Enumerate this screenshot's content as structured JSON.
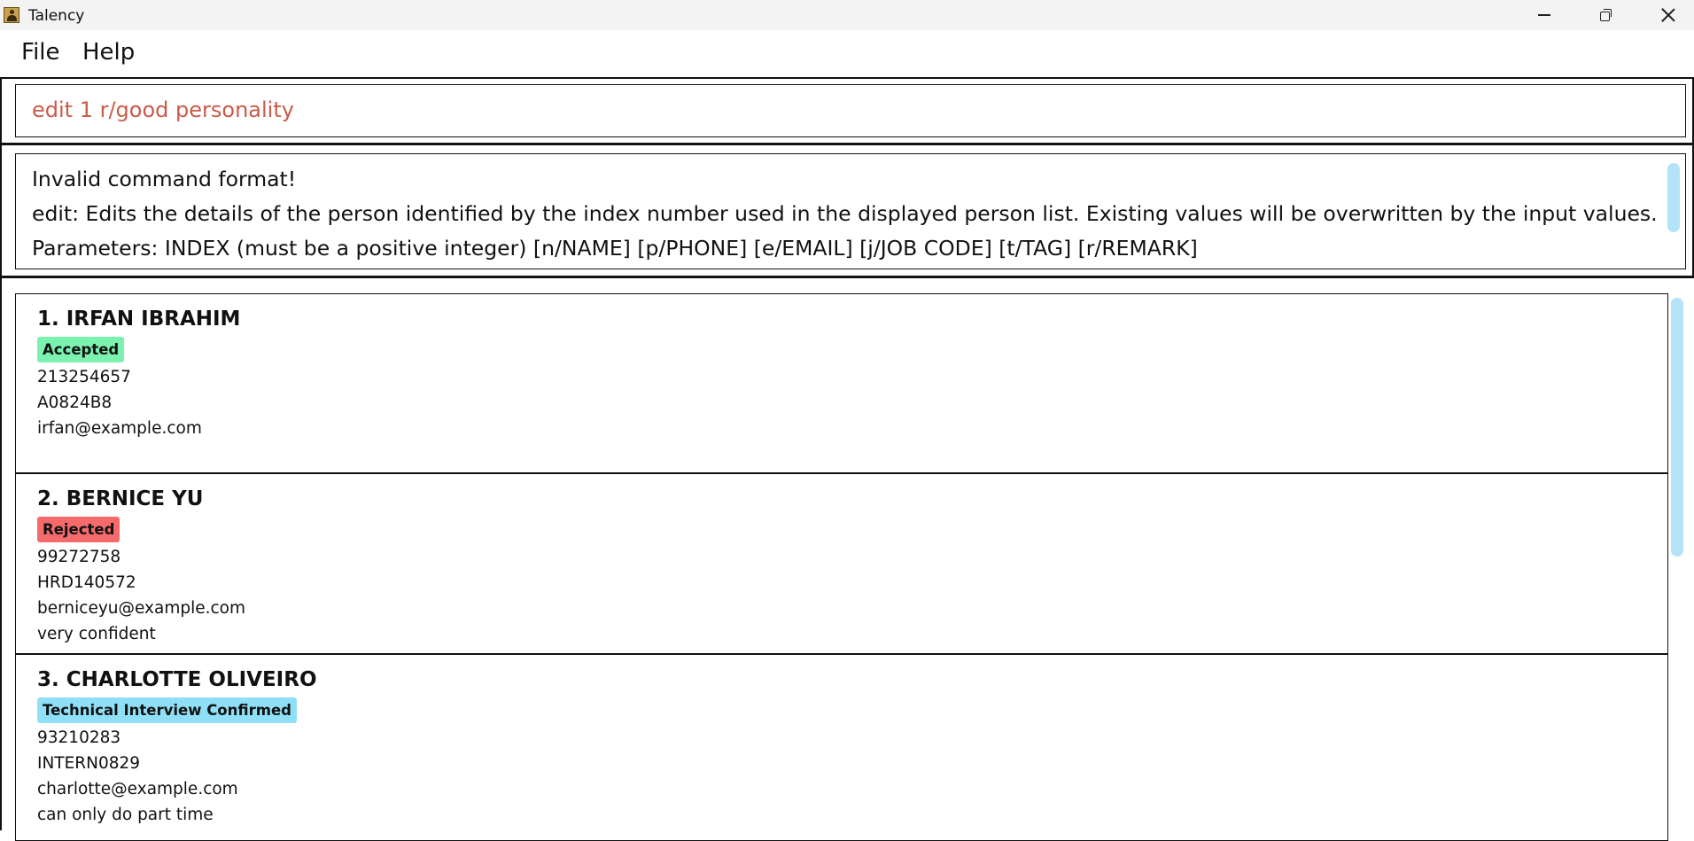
{
  "window": {
    "title": "Talency"
  },
  "menu": {
    "file_label": "File",
    "help_label": "Help"
  },
  "command": {
    "value": "edit 1 r/good personality"
  },
  "result": {
    "lines": [
      "Invalid command format!",
      "edit: Edits the details of the person identified by the index number used in the displayed person list. Existing values will be overwritten by the input values.",
      "Parameters: INDEX (must be a positive integer) [n/NAME] [p/PHONE] [e/EMAIL] [j/JOB CODE] [t/TAG] [r/REMARK]"
    ]
  },
  "persons": [
    {
      "name": "1. IRFAN IBRAHIM",
      "tag": "Accepted",
      "tag_color": "#7cf2b0",
      "phone": "213254657",
      "job_code": "A0824B8",
      "email": "irfan@example.com",
      "remark": ""
    },
    {
      "name": "2. BERNICE YU",
      "tag": "Rejected",
      "tag_color": "#f56b6b",
      "phone": "99272758",
      "job_code": "HRD140572",
      "email": "berniceyu@example.com",
      "remark": "very confident"
    },
    {
      "name": "3. CHARLOTTE OLIVEIRO",
      "tag": "Technical Interview Confirmed",
      "tag_color": "#8fe0f7",
      "phone": "93210283",
      "job_code": "INTERN0829",
      "email": "charlotte@example.com",
      "remark": "can only do part time"
    }
  ],
  "colors": {
    "command_text": "#c95b4a",
    "scrollbar": "#b3e3f7",
    "titlebar_bg": "#f3f3f3"
  },
  "icons": {
    "app": "talency-app-icon",
    "minimize": "minimize-icon",
    "maximize": "restore-icon",
    "close": "close-icon"
  }
}
